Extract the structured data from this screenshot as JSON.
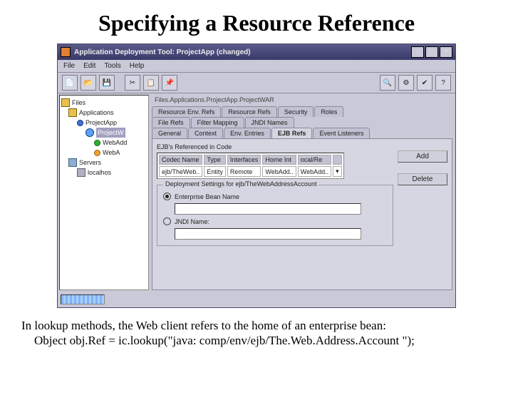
{
  "slide": {
    "title": "Specifying a Resource Reference",
    "body_line1": "In lookup methods, the Web client refers to the home of an enterprise bean:",
    "body_line2": "Object obj.Ref = ic.lookup(\"java: comp/env/ejb/The.Web.Address.Account \");"
  },
  "window": {
    "title": "Application Deployment Tool: ProjectApp (changed)",
    "menus": {
      "file": "File",
      "edit": "Edit",
      "tools": "Tools",
      "help": "Help"
    },
    "tree": {
      "root": "Files",
      "apps": "Applications",
      "proj": "ProjectApp",
      "projw": "ProjectW",
      "webadd": "WebAdd",
      "weba": "WebA",
      "servers": "Servers",
      "local": "localhos"
    },
    "path": "Files.Applications.ProjectApp.ProjectWAR",
    "tabs_upper": [
      "Resource Env. Refs",
      "Resource Refs",
      "Security",
      "Roles"
    ],
    "tabs_mid": [
      "File Refs",
      "Filter Mapping",
      "JNDI Names"
    ],
    "tabs_lower": [
      "General",
      "Context",
      "Env. Entries",
      "EJB Refs",
      "Event Listeners"
    ],
    "group_title": "EJB's Referenced in Code",
    "table": {
      "headers": [
        "Codec Name",
        "Type",
        "Interfaces",
        "Home Int",
        "ocal/Re",
        ""
      ],
      "row": [
        "ejb/TheWeb..",
        "Entity",
        "Remote",
        "WebAdd..",
        "WebAdd..",
        "▾"
      ]
    },
    "buttons": {
      "add": "Add",
      "delete": "Delete"
    },
    "deploy": {
      "legend": "Deployment Settings for ejb/TheWebAddressAccount",
      "r1": "Enterprise Bean Name",
      "r2": "JNDI Name:"
    }
  }
}
